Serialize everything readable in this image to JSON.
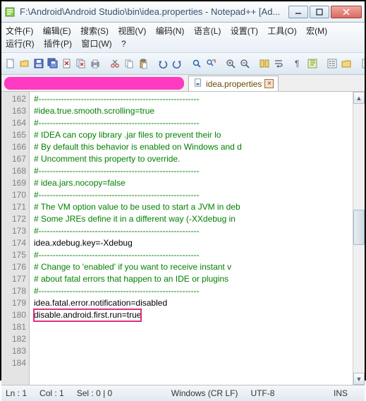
{
  "window": {
    "title": "F:\\Android\\Android Studio\\bin\\idea.properties - Notepad++ [Ad..."
  },
  "menu": {
    "file": "文件(F)",
    "edit": "编辑(E)",
    "search": "搜索(S)",
    "view": "视图(V)",
    "encoding": "编码(N)",
    "language": "语言(L)",
    "settings": "设置(T)",
    "tools": "工具(O)",
    "macro": "宏(M)",
    "run": "运行(R)",
    "plugins": "插件(P)",
    "window": "窗口(W)",
    "help": "?"
  },
  "tab": {
    "label": "idea.properties",
    "close": "×"
  },
  "lines": {
    "start": 162,
    "l162": "#---------------------------------------------------------",
    "l163": "#idea.true.smooth.scrolling=true",
    "l164": "",
    "l165": "#---------------------------------------------------------",
    "l166": "# IDEA can copy library .jar files to prevent their lo",
    "l167": "# By default this behavior is enabled on Windows and d",
    "l168": "# Uncomment this property to override.",
    "l169": "#---------------------------------------------------------",
    "l170": "# idea.jars.nocopy=false",
    "l171": "",
    "l172": "#---------------------------------------------------------",
    "l173": "# The VM option value to be used to start a JVM in deb",
    "l174": "# Some JREs define it in a different way (-XXdebug in ",
    "l175": "#---------------------------------------------------------",
    "l176": "idea.xdebug.key=-Xdebug",
    "l177": "",
    "l178": "#---------------------------------------------------------",
    "l179": "# Change to 'enabled' if you want to receive instant v",
    "l180": "# about fatal errors that happen to an IDE or plugins ",
    "l181": "#---------------------------------------------------------",
    "l182": "idea.fatal.error.notification=disabled",
    "l183": "disable.android.first.run=true",
    "l184": ""
  },
  "status": {
    "ln": "Ln : 1",
    "col": "Col : 1",
    "sel": "Sel : 0 | 0",
    "eol": "Windows (CR LF)",
    "enc": "UTF-8",
    "mode": "INS"
  }
}
